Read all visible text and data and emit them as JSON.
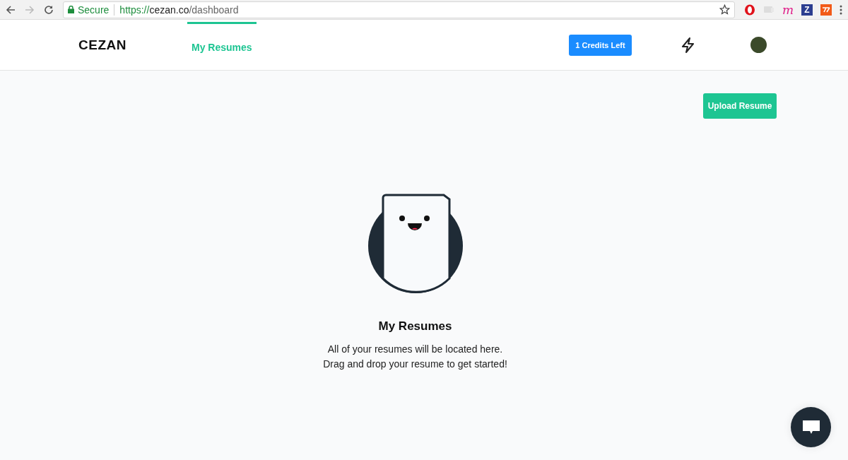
{
  "browser": {
    "secure_label": "Secure",
    "url_scheme": "https://",
    "url_host": "cezan.co",
    "url_path": "/dashboard",
    "extensions": [
      {
        "kind": "opera"
      },
      {
        "kind": "cast"
      },
      {
        "kind": "letter",
        "text": "m"
      },
      {
        "kind": "badge",
        "text": "Z"
      },
      {
        "kind": "code"
      }
    ]
  },
  "header": {
    "logo": "CEZAN",
    "tabs": [
      {
        "label": "My Resumes",
        "selected": true
      }
    ],
    "credits_button": "1 Credits Left"
  },
  "toolbar": {
    "upload_button": "Upload Resume"
  },
  "empty_state": {
    "title": "My Resumes",
    "lines": [
      "All of your resumes will be located here.",
      "Drag and drop your resume to get started!"
    ]
  }
}
